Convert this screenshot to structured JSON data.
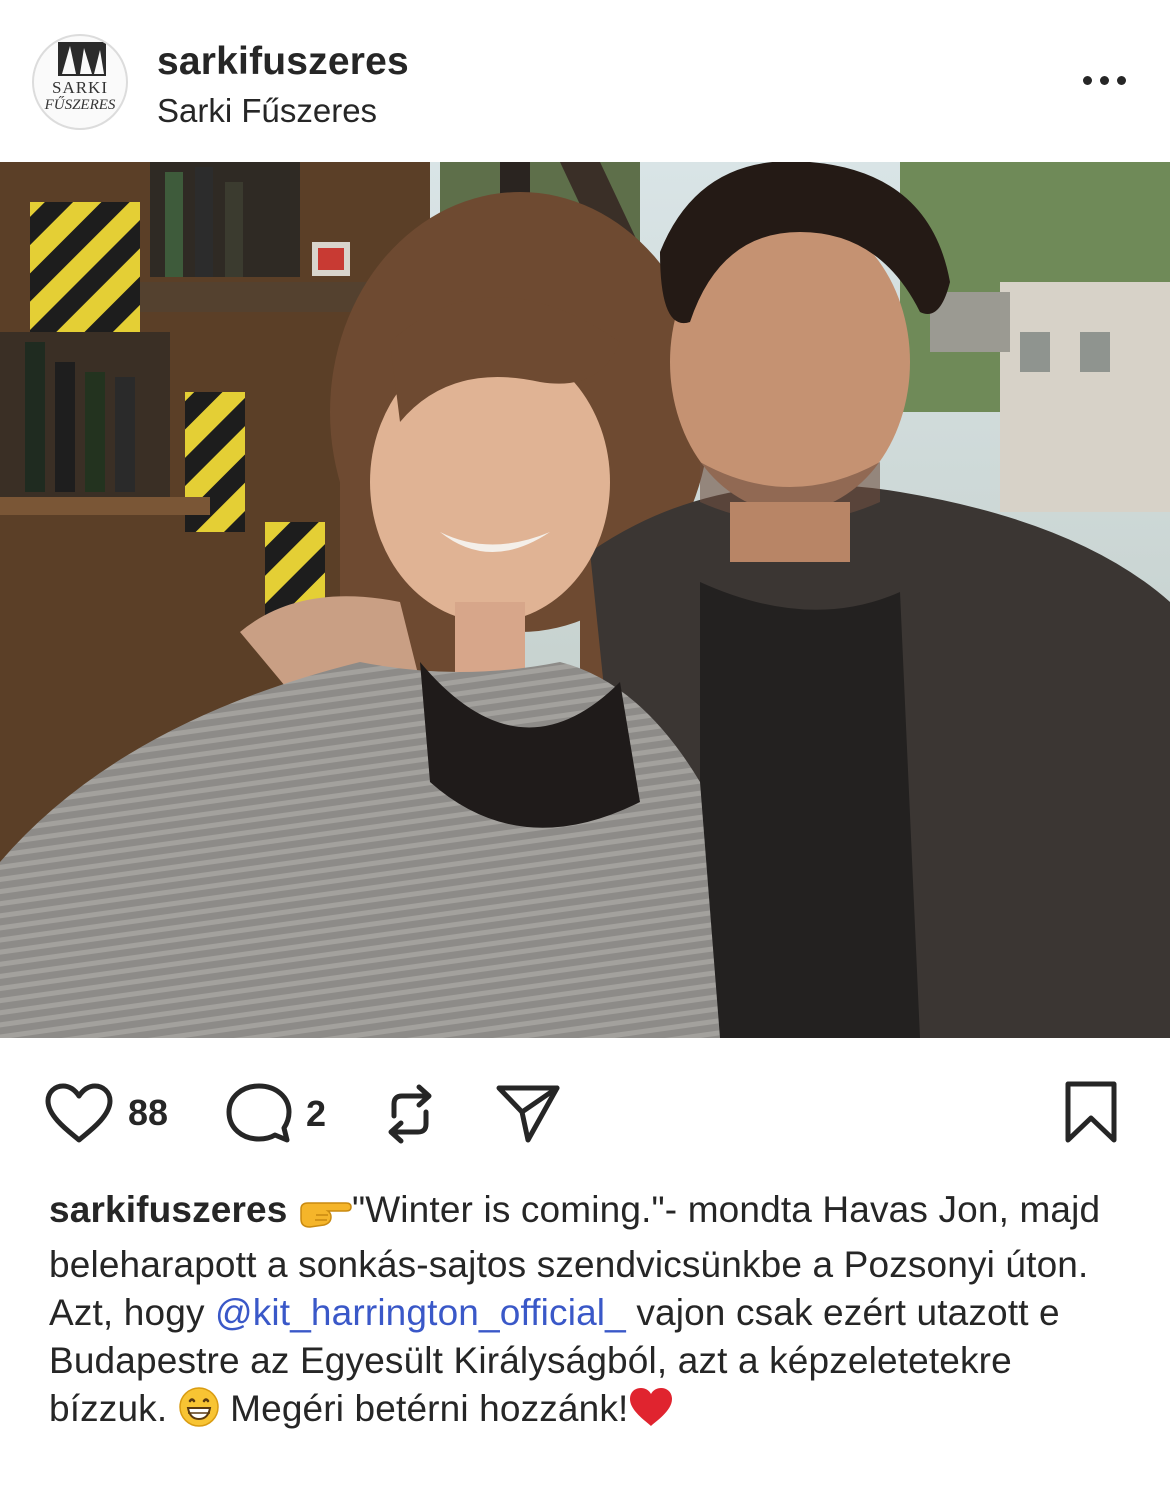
{
  "header": {
    "avatar_text_line1": "SARKI",
    "avatar_text_line2": "FŰSZERES",
    "username": "sarkifuszeres",
    "subtitle": "Sarki Fűszeres",
    "more_icon": "more-horizontal-icon"
  },
  "photo": {
    "mute_icon": "speaker-muted-icon"
  },
  "actions": {
    "like_icon": "heart-icon",
    "like_count": "88",
    "comment_icon": "comment-bubble-icon",
    "comment_count": "2",
    "repost_icon": "repost-icon",
    "share_icon": "paper-plane-icon",
    "save_icon": "bookmark-icon"
  },
  "caption": {
    "username": "sarkifuszeres",
    "text_part1": "\"Winter is coming.\"- mondta Havas Jon, majd beleharapott a sonkás-sajtos szendvicsünkbe a Pozsonyi úton. Azt, hogy ",
    "mention": "@kit_harrington_official_",
    "text_part2": " vajon csak ezért utazott e Budapestre az Egyesült Királyságból, azt a képzeletetekre bízzuk. ",
    "text_part3": " Megéri betérni hozzánk!",
    "emoji_pointing": "pointing-hand-emoji",
    "emoji_grin": "grinning-face-emoji",
    "emoji_heart": "red-heart-emoji"
  },
  "colors": {
    "text": "#262626",
    "mention": "#3a58c8",
    "heart_emoji": "#e0242f",
    "background": "#ffffff"
  }
}
